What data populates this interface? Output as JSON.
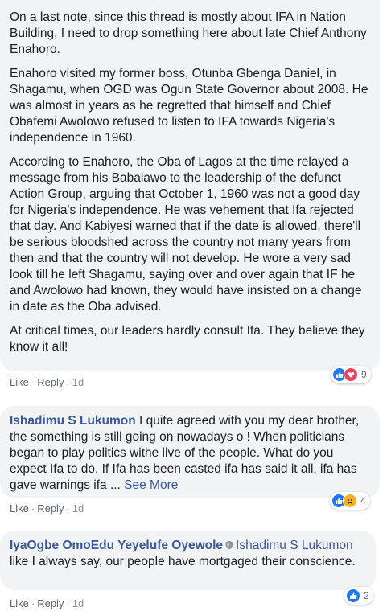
{
  "comment1": {
    "paragraphs": [
      "On a last note, since this thread is mostly about IFA in Nation Building, I need to drop something here about late Chief Anthony Enahoro.",
      "Enahoro visited my former boss, Otunba Gbenga Daniel, in Shagamu, when OGD was Ogun State Governor about 2008. He was almost in years as he regretted that himself and Chief Obafemi Awolowo refused to listen to IFA towards Nigeria's independence in 1960.",
      "According to Enahoro, the Oba of Lagos at the time relayed a message from his Babalawo to the leadership of the defunct Action Group, arguing that October 1, 1960 was not a good day for Nigeria's independence. He was vehement that Ifa rejected that day. And Kabiyesi warned that if the date is allowed, there'll be serious bloodshed across the country not many years from then and that the country will not develop. He wore a very sad look till he left Shagamu, saying over and over again that IF he and Awolowo had known, they would have insisted on a change in date as the Oba advised.",
      "At critical times, our leaders hardly consult Ifa. They believe they know it all!"
    ],
    "like_label": "Like",
    "reply_label": "Reply",
    "time": "1d",
    "reaction_count": "9",
    "reactions": [
      "like-icon",
      "love-icon"
    ]
  },
  "comment2": {
    "author": "Ishadimu S Lukumon",
    "text": " I quite agreed with you my dear brother, the something is still going on nowadays o ! When politicians began to play politics withe live of the people. What do you expect Ifa to do, If Ifa has been casted ifa has said it all, ifa has gave warnings ifa ",
    "ellipsis": "...",
    "see_more": "See More",
    "like_label": "Like",
    "reply_label": "Reply",
    "time": "1d",
    "reaction_count": "4",
    "reactions": [
      "like-icon",
      "sad-icon"
    ]
  },
  "comment3": {
    "author": "IyaOgbe OmoEdu Yeyelufe Oyewole",
    "tagged": "Ishadimu S Lukumon",
    "text": " like I always say, our people have mortgaged their conscience.",
    "like_label": "Like",
    "reply_label": "Reply",
    "time": "1d",
    "reaction_count": "2",
    "reactions": [
      "like-icon"
    ]
  },
  "colors": {
    "bubble": "#f2f3f5",
    "link": "#385898",
    "meta": "#606770",
    "like": "#2078f4",
    "love": "#f33e58",
    "sad": "#f7b125"
  }
}
